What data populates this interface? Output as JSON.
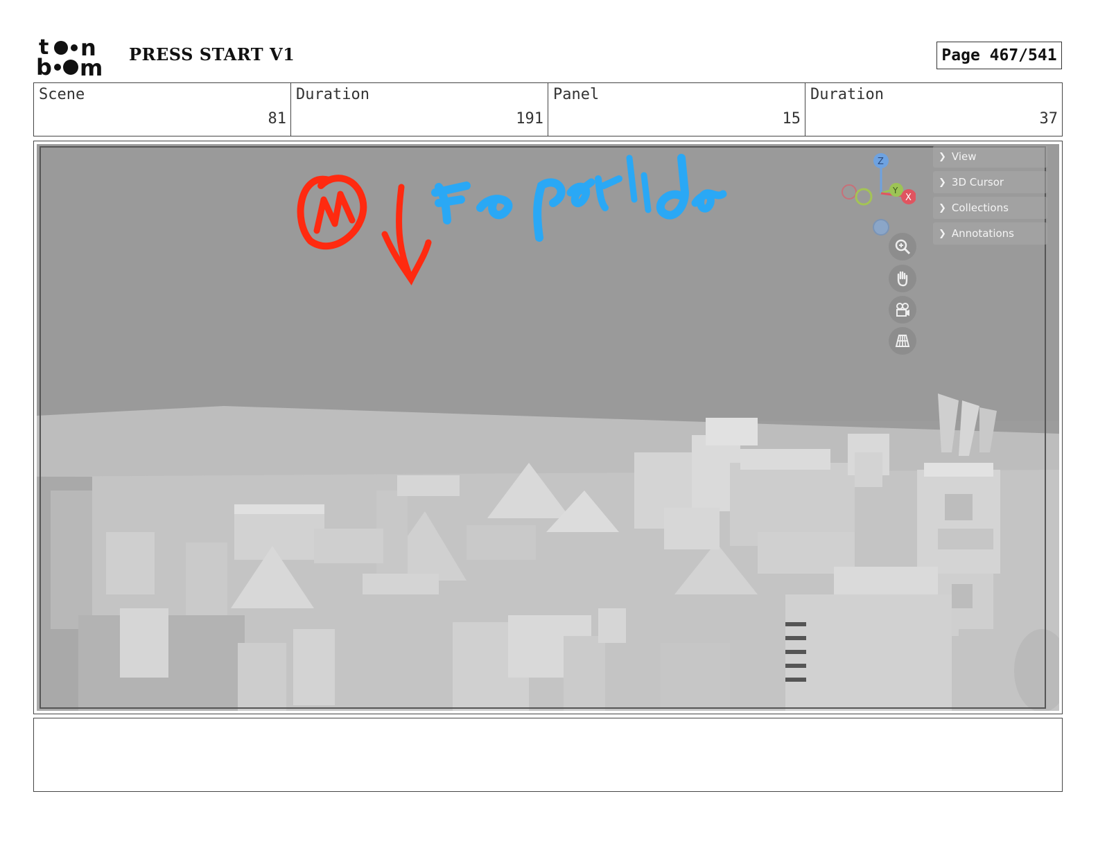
{
  "header": {
    "logo_text_top": "toon",
    "logo_text_bottom": "boom",
    "project_title": "PRESS START V1",
    "page_label": "Page 467/541"
  },
  "info": [
    {
      "label": "Scene",
      "value": "81"
    },
    {
      "label": "Duration",
      "value": "191"
    },
    {
      "label": "Panel",
      "value": "15"
    },
    {
      "label": "Duration",
      "value": "37"
    }
  ],
  "viewport": {
    "sidebar_items": [
      "View",
      "3D Cursor",
      "Collections",
      "Annotations"
    ],
    "gizmo_axes": [
      "Z",
      "Y",
      "X"
    ],
    "nav_tools": [
      "zoom-icon",
      "hand-pan-icon",
      "camera-icon",
      "grid-perspective-icon"
    ],
    "annotation_colors": {
      "red": "#ff2a10",
      "blue": "#2aa8f5"
    }
  },
  "notes": {
    "text": ""
  }
}
